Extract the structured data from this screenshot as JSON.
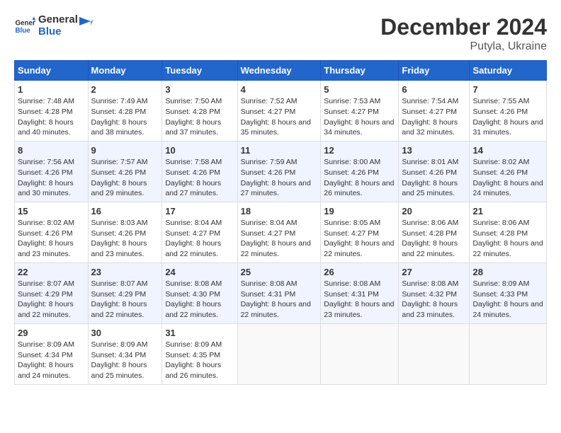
{
  "logo": {
    "line1": "General",
    "line2": "Blue"
  },
  "title": "December 2024",
  "subtitle": "Putyla, Ukraine",
  "days_of_week": [
    "Sunday",
    "Monday",
    "Tuesday",
    "Wednesday",
    "Thursday",
    "Friday",
    "Saturday"
  ],
  "weeks": [
    [
      {
        "day": "1",
        "sunrise": "7:48 AM",
        "sunset": "4:28 PM",
        "daylight": "8 hours and 40 minutes."
      },
      {
        "day": "2",
        "sunrise": "7:49 AM",
        "sunset": "4:28 PM",
        "daylight": "8 hours and 38 minutes."
      },
      {
        "day": "3",
        "sunrise": "7:50 AM",
        "sunset": "4:28 PM",
        "daylight": "8 hours and 37 minutes."
      },
      {
        "day": "4",
        "sunrise": "7:52 AM",
        "sunset": "4:27 PM",
        "daylight": "8 hours and 35 minutes."
      },
      {
        "day": "5",
        "sunrise": "7:53 AM",
        "sunset": "4:27 PM",
        "daylight": "8 hours and 34 minutes."
      },
      {
        "day": "6",
        "sunrise": "7:54 AM",
        "sunset": "4:27 PM",
        "daylight": "8 hours and 32 minutes."
      },
      {
        "day": "7",
        "sunrise": "7:55 AM",
        "sunset": "4:26 PM",
        "daylight": "8 hours and 31 minutes."
      }
    ],
    [
      {
        "day": "8",
        "sunrise": "7:56 AM",
        "sunset": "4:26 PM",
        "daylight": "8 hours and 30 minutes."
      },
      {
        "day": "9",
        "sunrise": "7:57 AM",
        "sunset": "4:26 PM",
        "daylight": "8 hours and 29 minutes."
      },
      {
        "day": "10",
        "sunrise": "7:58 AM",
        "sunset": "4:26 PM",
        "daylight": "8 hours and 27 minutes."
      },
      {
        "day": "11",
        "sunrise": "7:59 AM",
        "sunset": "4:26 PM",
        "daylight": "8 hours and 27 minutes."
      },
      {
        "day": "12",
        "sunrise": "8:00 AM",
        "sunset": "4:26 PM",
        "daylight": "8 hours and 26 minutes."
      },
      {
        "day": "13",
        "sunrise": "8:01 AM",
        "sunset": "4:26 PM",
        "daylight": "8 hours and 25 minutes."
      },
      {
        "day": "14",
        "sunrise": "8:02 AM",
        "sunset": "4:26 PM",
        "daylight": "8 hours and 24 minutes."
      }
    ],
    [
      {
        "day": "15",
        "sunrise": "8:02 AM",
        "sunset": "4:26 PM",
        "daylight": "8 hours and 23 minutes."
      },
      {
        "day": "16",
        "sunrise": "8:03 AM",
        "sunset": "4:26 PM",
        "daylight": "8 hours and 23 minutes."
      },
      {
        "day": "17",
        "sunrise": "8:04 AM",
        "sunset": "4:27 PM",
        "daylight": "8 hours and 22 minutes."
      },
      {
        "day": "18",
        "sunrise": "8:04 AM",
        "sunset": "4:27 PM",
        "daylight": "8 hours and 22 minutes."
      },
      {
        "day": "19",
        "sunrise": "8:05 AM",
        "sunset": "4:27 PM",
        "daylight": "8 hours and 22 minutes."
      },
      {
        "day": "20",
        "sunrise": "8:06 AM",
        "sunset": "4:28 PM",
        "daylight": "8 hours and 22 minutes."
      },
      {
        "day": "21",
        "sunrise": "8:06 AM",
        "sunset": "4:28 PM",
        "daylight": "8 hours and 22 minutes."
      }
    ],
    [
      {
        "day": "22",
        "sunrise": "8:07 AM",
        "sunset": "4:29 PM",
        "daylight": "8 hours and 22 minutes."
      },
      {
        "day": "23",
        "sunrise": "8:07 AM",
        "sunset": "4:29 PM",
        "daylight": "8 hours and 22 minutes."
      },
      {
        "day": "24",
        "sunrise": "8:08 AM",
        "sunset": "4:30 PM",
        "daylight": "8 hours and 22 minutes."
      },
      {
        "day": "25",
        "sunrise": "8:08 AM",
        "sunset": "4:31 PM",
        "daylight": "8 hours and 22 minutes."
      },
      {
        "day": "26",
        "sunrise": "8:08 AM",
        "sunset": "4:31 PM",
        "daylight": "8 hours and 23 minutes."
      },
      {
        "day": "27",
        "sunrise": "8:08 AM",
        "sunset": "4:32 PM",
        "daylight": "8 hours and 23 minutes."
      },
      {
        "day": "28",
        "sunrise": "8:09 AM",
        "sunset": "4:33 PM",
        "daylight": "8 hours and 24 minutes."
      }
    ],
    [
      {
        "day": "29",
        "sunrise": "8:09 AM",
        "sunset": "4:34 PM",
        "daylight": "8 hours and 24 minutes."
      },
      {
        "day": "30",
        "sunrise": "8:09 AM",
        "sunset": "4:34 PM",
        "daylight": "8 hours and 25 minutes."
      },
      {
        "day": "31",
        "sunrise": "8:09 AM",
        "sunset": "4:35 PM",
        "daylight": "8 hours and 26 minutes."
      },
      null,
      null,
      null,
      null
    ]
  ],
  "labels": {
    "sunrise": "Sunrise:",
    "sunset": "Sunset:",
    "daylight": "Daylight:"
  }
}
